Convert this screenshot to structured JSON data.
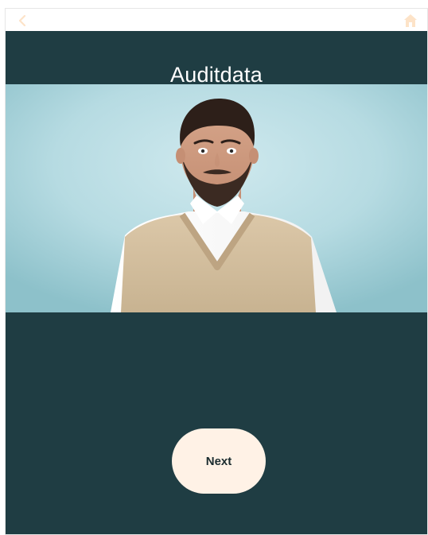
{
  "header": {
    "back_icon": "chevron-left-icon",
    "home_icon": "home-icon",
    "icon_color": "#fde3c8"
  },
  "main": {
    "title": "Auditdata",
    "image_subject": "person",
    "next_label": "Next"
  },
  "colors": {
    "app_background": "#1f3d43",
    "button_background": "#fff2e6",
    "image_background": "#b6dbe2"
  }
}
